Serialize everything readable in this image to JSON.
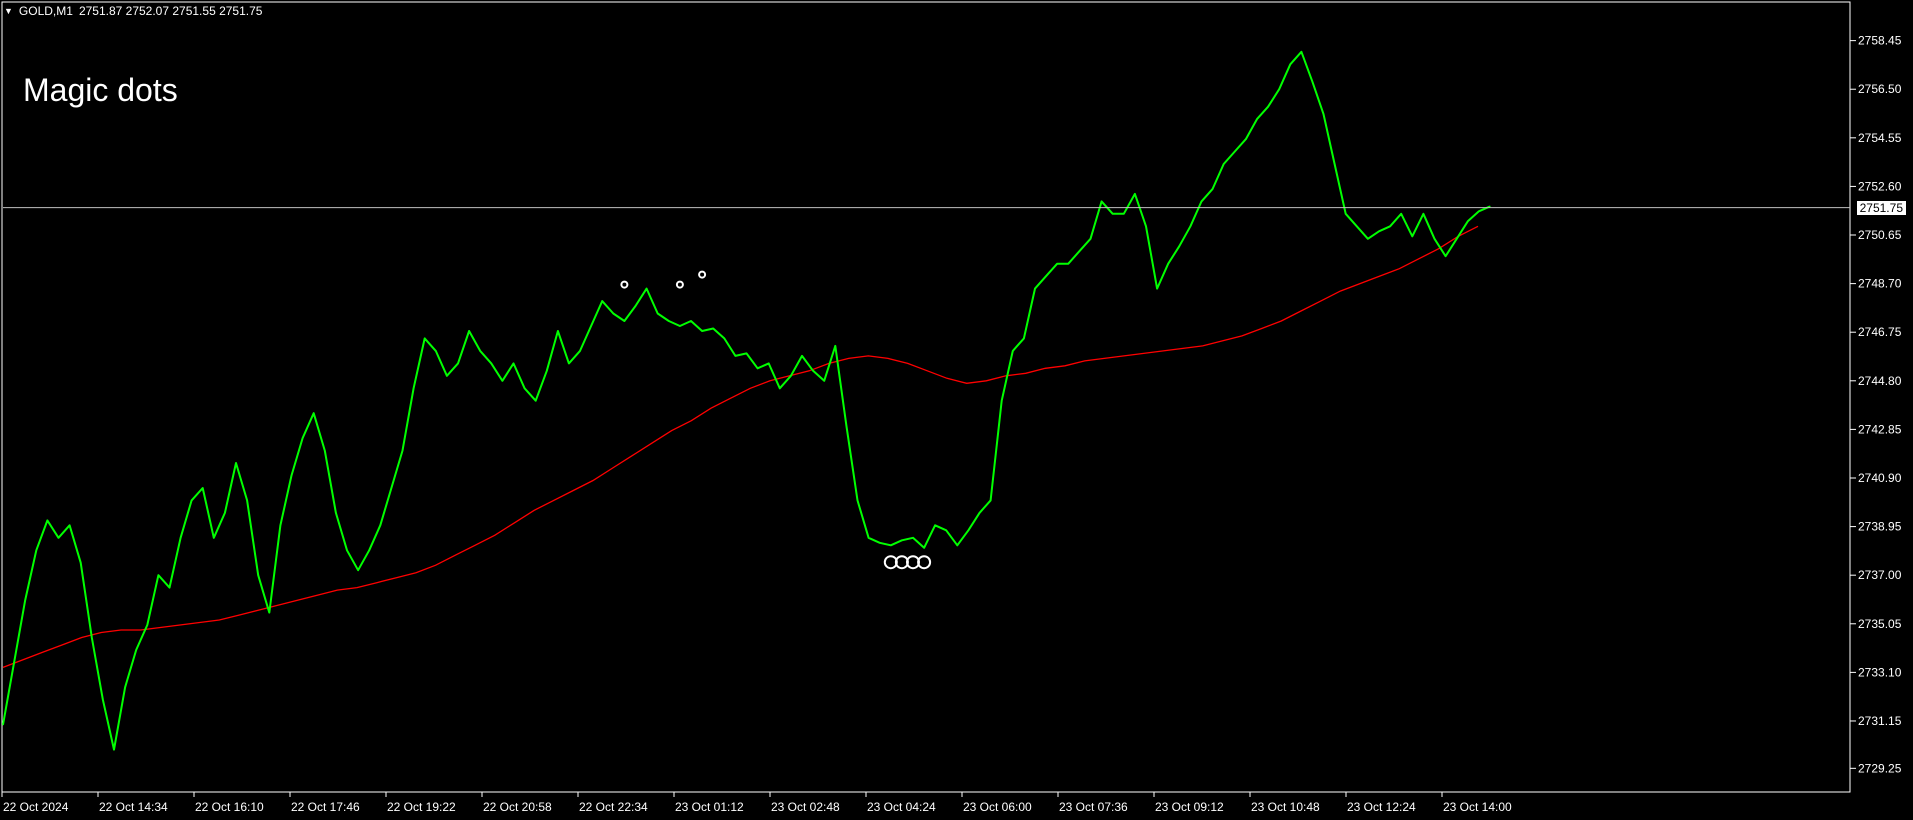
{
  "header": {
    "menu_icon": "triangle-down-icon",
    "symbol_timeframe": "GOLD,M1",
    "ohlc": "2751.87 2752.07 2751.55 2751.75"
  },
  "overlay_text": "Magic dots",
  "colors": {
    "background": "#000000",
    "price_line": "#00ff00",
    "moving_average": "#ff0000",
    "axis": "#ffffff",
    "current_price_line": "#c0c0c0",
    "dots": "#ffffff"
  },
  "current_price_label": "2751.75",
  "chart_data": {
    "type": "line",
    "title": "",
    "xlabel": "",
    "ylabel": "",
    "ylim": [
      2728.3,
      2760.0
    ],
    "grid": false,
    "y_ticks": [
      "2758.45",
      "2756.50",
      "2754.55",
      "2752.60",
      "2750.65",
      "2748.70",
      "2746.75",
      "2744.80",
      "2742.85",
      "2740.90",
      "2738.95",
      "2737.00",
      "2735.05",
      "2733.10",
      "2731.15",
      "2729.25"
    ],
    "x_ticks": [
      "22 Oct 2024",
      "22 Oct 14:34",
      "22 Oct 16:10",
      "22 Oct 17:46",
      "22 Oct 19:22",
      "22 Oct 20:58",
      "22 Oct 22:34",
      "23 Oct 01:12",
      "23 Oct 02:48",
      "23 Oct 04:24",
      "23 Oct 06:00",
      "23 Oct 07:36",
      "23 Oct 09:12",
      "23 Oct 10:48",
      "23 Oct 12:24",
      "23 Oct 14:00"
    ],
    "current_price": 2751.75,
    "series": [
      {
        "role": "price",
        "values": [
          2731.0,
          2733.5,
          2736.0,
          2738.0,
          2739.2,
          2738.5,
          2739.0,
          2737.5,
          2734.5,
          2732.0,
          2730.0,
          2732.5,
          2734.0,
          2735.0,
          2737.0,
          2736.5,
          2738.5,
          2740.0,
          2740.5,
          2738.5,
          2739.5,
          2741.5,
          2740.0,
          2737.0,
          2735.5,
          2739.0,
          2741.0,
          2742.5,
          2743.5,
          2742.0,
          2739.5,
          2738.0,
          2737.2,
          2738.0,
          2739.0,
          2740.5,
          2742.0,
          2744.5,
          2746.5,
          2746.0,
          2745.0,
          2745.5,
          2746.8,
          2746.0,
          2745.5,
          2744.8,
          2745.5,
          2744.5,
          2744.0,
          2745.2,
          2746.8,
          2745.5,
          2746.0,
          2747.0,
          2748.0,
          2747.5,
          2747.2,
          2747.8,
          2748.5,
          2747.5,
          2747.2,
          2747.0,
          2747.2,
          2746.8,
          2746.9,
          2746.5,
          2745.8,
          2745.9,
          2745.3,
          2745.5,
          2744.5,
          2745.0,
          2745.8,
          2745.2,
          2744.8,
          2746.2,
          2743.0,
          2740.0,
          2738.5,
          2738.3,
          2738.2,
          2738.4,
          2738.5,
          2738.1,
          2739.0,
          2738.8,
          2738.2,
          2738.8,
          2739.5,
          2740.0,
          2744.0,
          2746.0,
          2746.5,
          2748.5,
          2749.0,
          2749.5,
          2749.5,
          2750.0,
          2750.5,
          2752.0,
          2751.5,
          2751.5,
          2752.3,
          2751.0,
          2748.5,
          2749.5,
          2750.2,
          2751.0,
          2752.0,
          2752.5,
          2753.5,
          2754.0,
          2754.5,
          2755.3,
          2755.8,
          2756.5,
          2757.5,
          2758.0,
          2756.8,
          2755.5,
          2753.5,
          2751.5,
          2751.0,
          2750.5,
          2750.8,
          2751.0,
          2751.5,
          2750.6,
          2751.5,
          2750.5,
          2749.8,
          2750.5,
          2751.2,
          2751.6,
          2751.8
        ]
      },
      {
        "role": "moving-average",
        "values": [
          2733.3,
          2733.6,
          2733.9,
          2734.2,
          2734.5,
          2734.7,
          2734.8,
          2734.8,
          2734.9,
          2735.0,
          2735.1,
          2735.2,
          2735.4,
          2735.6,
          2735.8,
          2736.0,
          2736.2,
          2736.4,
          2736.5,
          2736.7,
          2736.9,
          2737.1,
          2737.4,
          2737.8,
          2738.2,
          2738.6,
          2739.1,
          2739.6,
          2740.0,
          2740.4,
          2740.8,
          2741.3,
          2741.8,
          2742.3,
          2742.8,
          2743.2,
          2743.7,
          2744.1,
          2744.5,
          2744.8,
          2745.0,
          2745.2,
          2745.5,
          2745.7,
          2745.8,
          2745.7,
          2745.5,
          2745.2,
          2744.9,
          2744.7,
          2744.8,
          2745.0,
          2745.1,
          2745.3,
          2745.4,
          2745.6,
          2745.7,
          2745.8,
          2745.9,
          2746.0,
          2746.1,
          2746.2,
          2746.4,
          2746.6,
          2746.9,
          2747.2,
          2747.6,
          2748.0,
          2748.4,
          2748.7,
          2749.0,
          2749.3,
          2749.7,
          2750.1,
          2750.6,
          2751.0
        ]
      }
    ],
    "markers": [
      {
        "kind": "top-dot",
        "x_index": 56,
        "value": 2748.5
      },
      {
        "kind": "top-dot",
        "x_index": 61,
        "value": 2748.5
      },
      {
        "kind": "top-dot",
        "x_index": 63,
        "value": 2748.9
      },
      {
        "kind": "bottom-dot",
        "x_index": 80,
        "value": 2737.6
      },
      {
        "kind": "bottom-dot",
        "x_index": 81,
        "value": 2737.6
      },
      {
        "kind": "bottom-dot",
        "x_index": 82,
        "value": 2737.6
      },
      {
        "kind": "bottom-dot",
        "x_index": 83,
        "value": 2737.6
      }
    ]
  }
}
